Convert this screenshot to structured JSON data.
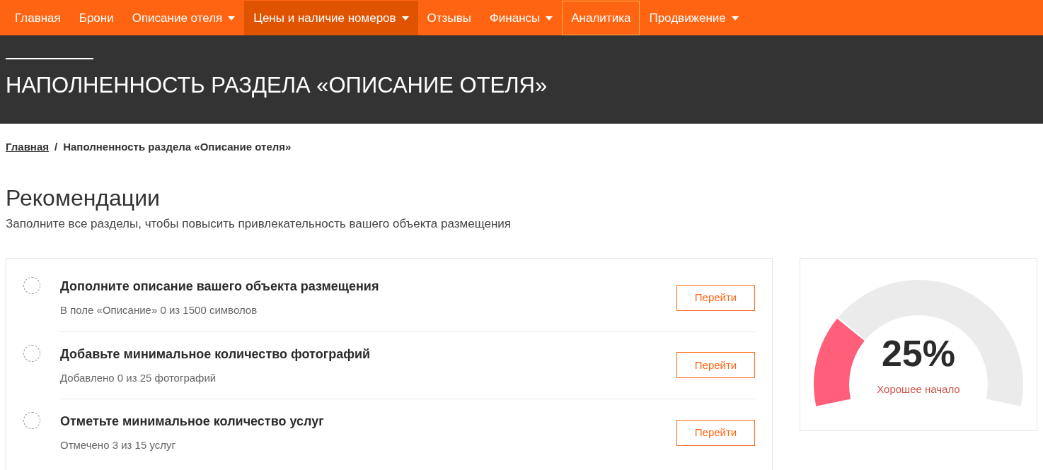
{
  "nav": [
    {
      "label": "Главная",
      "dropdown": false,
      "hovered": false,
      "focused": false
    },
    {
      "label": "Брони",
      "dropdown": false,
      "hovered": false,
      "focused": false
    },
    {
      "label": "Описание отеля",
      "dropdown": true,
      "hovered": false,
      "focused": false
    },
    {
      "label": "Цены и наличие номеров",
      "dropdown": true,
      "hovered": true,
      "focused": false
    },
    {
      "label": "Отзывы",
      "dropdown": false,
      "hovered": false,
      "focused": false
    },
    {
      "label": "Финансы",
      "dropdown": true,
      "hovered": false,
      "focused": false
    },
    {
      "label": "Аналитика",
      "dropdown": false,
      "hovered": false,
      "focused": true
    },
    {
      "label": "Продвижение",
      "dropdown": true,
      "hovered": false,
      "focused": false
    }
  ],
  "header": {
    "title": "НАПОЛНЕННОСТЬ РАЗДЕЛА «ОПИСАНИЕ ОТЕЛЯ»"
  },
  "breadcrumb": [
    {
      "label": "Главная",
      "link": true
    },
    {
      "label": "/",
      "link": false
    },
    {
      "label": "Наполненность раздела «Описание отеля»",
      "link": false
    }
  ],
  "recommendations": {
    "title": "Рекомендации",
    "subtitle": "Заполните все разделы, чтобы повысить привлекательность вашего объекта размещения",
    "items": [
      {
        "title": "Дополните описание вашего объекта размещения",
        "detail": "В поле «Описание» 0 из 1500 символов",
        "done": false,
        "button": "Перейти"
      },
      {
        "title": "Добавьте минимальное количество фотографий",
        "detail": "Добавлено 0 из 25 фотографий",
        "done": false,
        "button": "Перейти"
      },
      {
        "title": "Отметьте минимальное количество услуг",
        "detail": "Отмечено 3 из 15 услуг",
        "done": false,
        "button": "Перейти"
      }
    ]
  },
  "gauge": {
    "level": 0.25,
    "value": "25%",
    "caption": "Хорошее начало"
  }
}
